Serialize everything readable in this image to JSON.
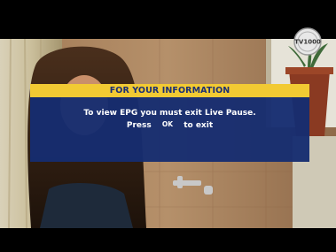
{
  "channel": {
    "logo_text": "TV1000"
  },
  "dialog": {
    "title": "FOR YOUR INFORMATION",
    "message": "To view EPG you must exit Live Pause.",
    "press_label": "Press",
    "ok_key": "OK",
    "exit_label": "to exit"
  },
  "colors": {
    "header_bg": "#f2ca33",
    "header_text": "#1b2f74",
    "body_bg": "#162d70",
    "body_text": "#ffffff"
  }
}
